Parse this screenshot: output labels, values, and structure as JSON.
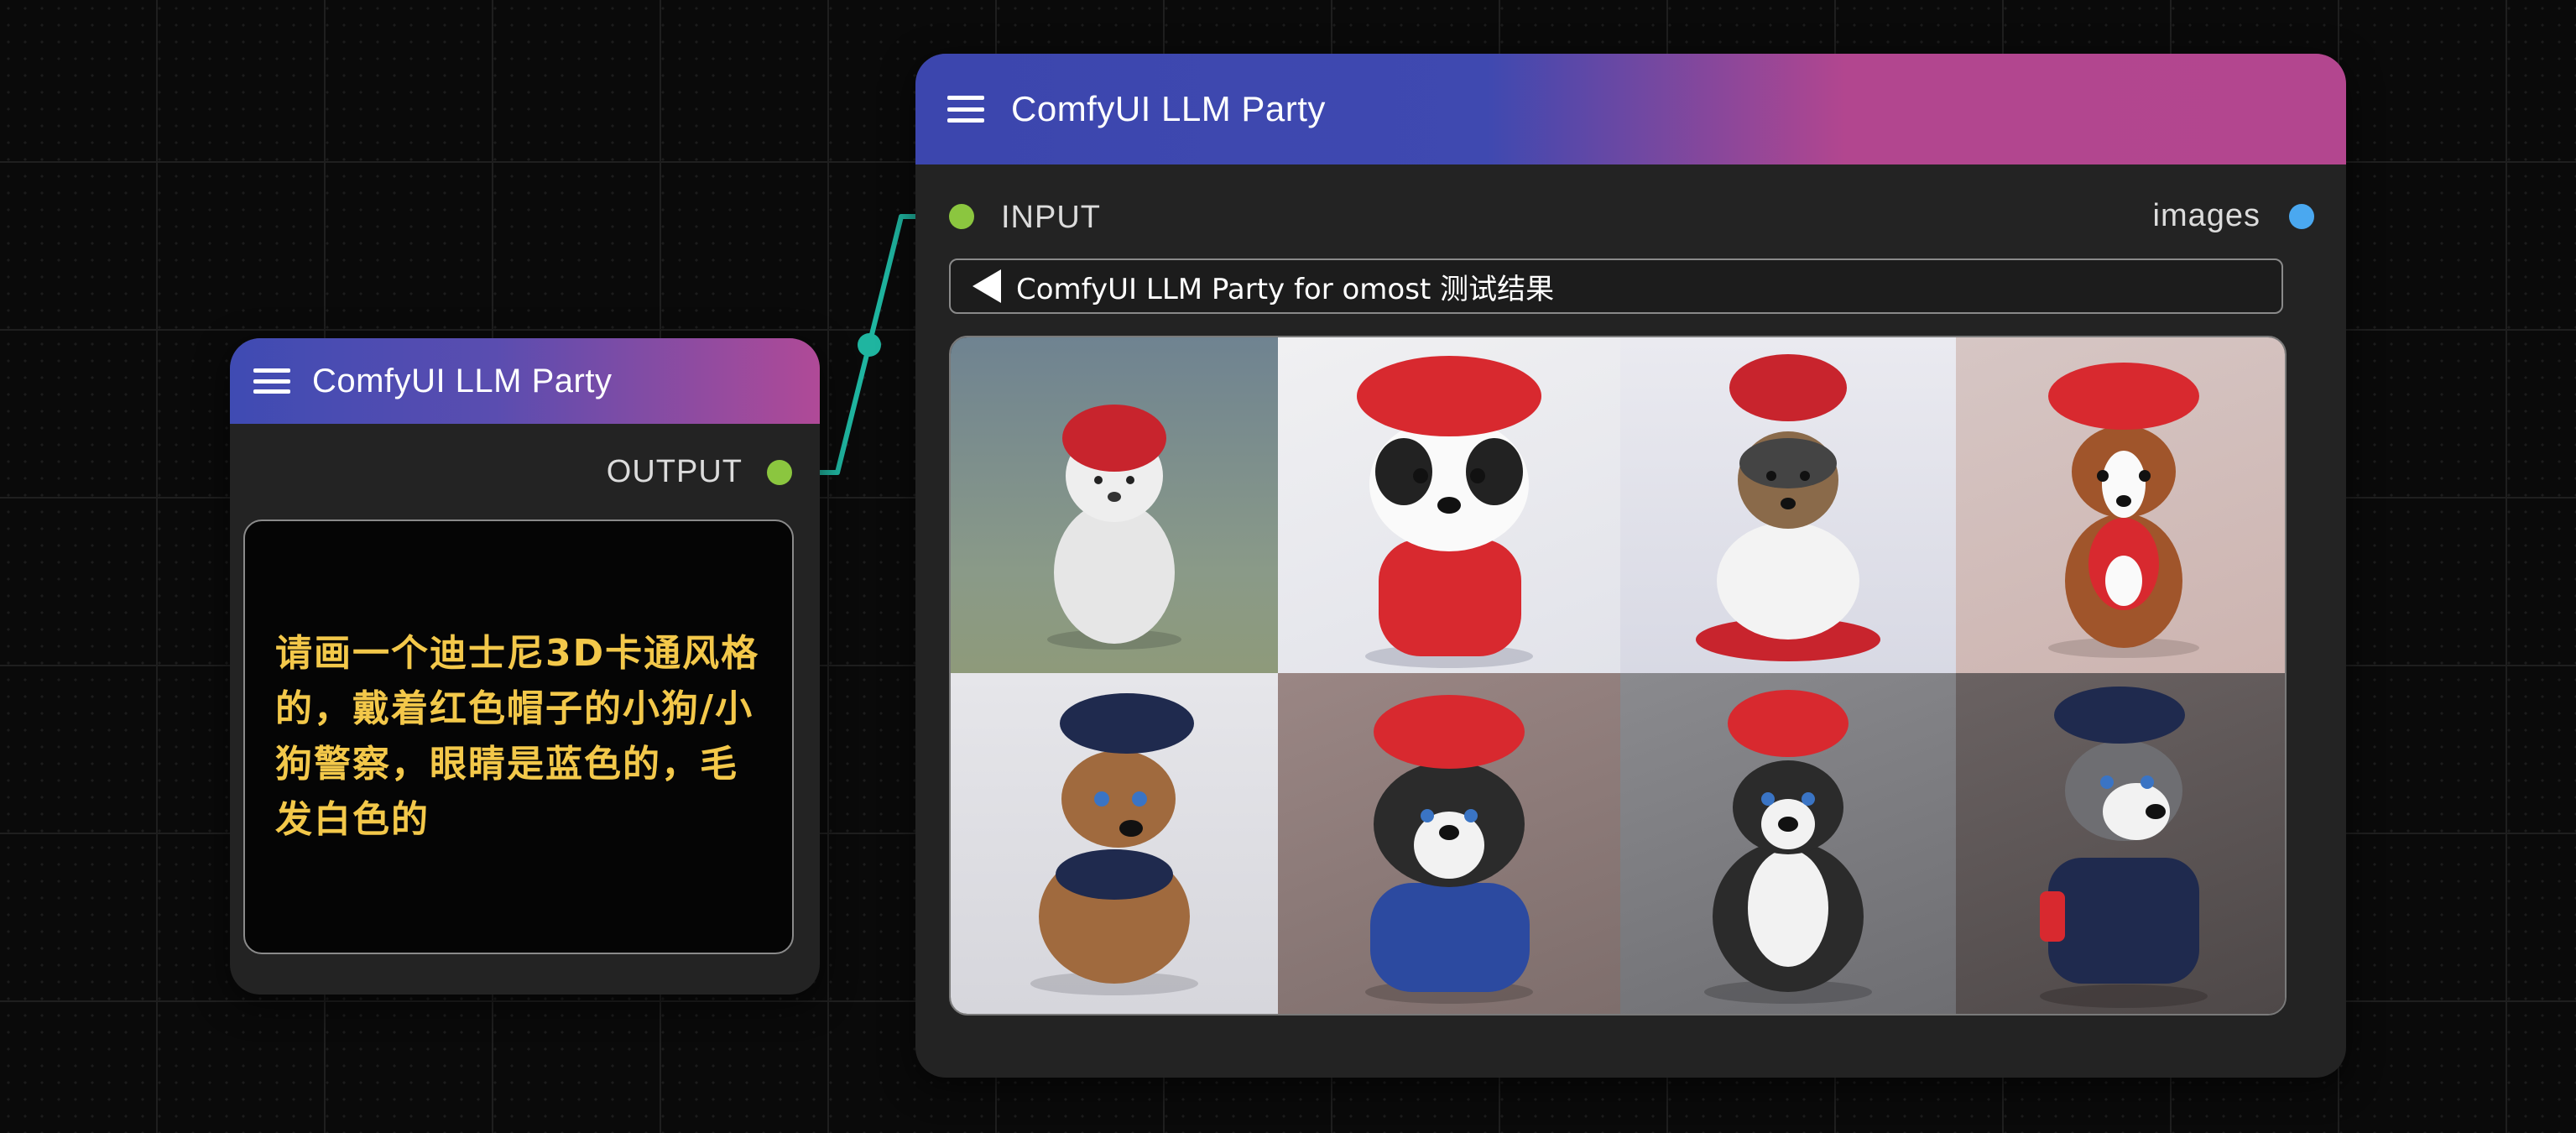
{
  "left_node": {
    "title": "ComfyUI LLM Party",
    "output_label": "OUTPUT",
    "prompt_text": "请画一个迪士尼3D卡通风格的，戴着红色帽子的小狗/小狗警察，眼睛是蓝色的，毛发白色的"
  },
  "right_node": {
    "title": "ComfyUI LLM Party",
    "input_label": "INPUT",
    "output_label": "images",
    "image_title": "ComfyUI LLM Party for omost 测试结果",
    "images": [
      {
        "name": "white-fluffy-puppy-red-beanie"
      },
      {
        "name": "black-white-puppy-red-beret"
      },
      {
        "name": "terrier-red-chef-hat"
      },
      {
        "name": "brown-white-puppy-red-cap"
      },
      {
        "name": "brown-puppy-navy-police-cap"
      },
      {
        "name": "black-tan-puppy-red-police-cap"
      },
      {
        "name": "tricolor-puppy-red-police-cap"
      },
      {
        "name": "husky-navy-police-uniform"
      }
    ]
  },
  "colors": {
    "wire": "#1fb5a0",
    "output_port": "#8bc63f",
    "input_port": "#8bc63f",
    "images_port": "#4aa8f0",
    "prompt_text": "#f3c84a"
  }
}
